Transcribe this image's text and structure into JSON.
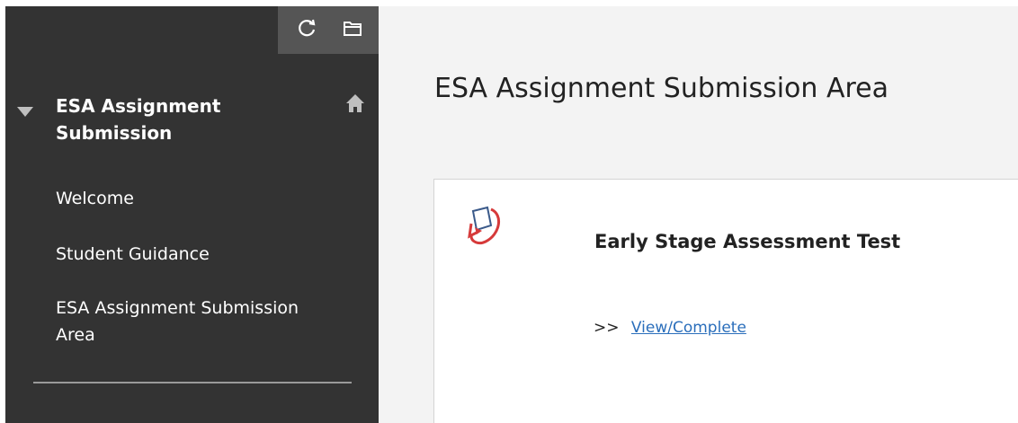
{
  "sidebar": {
    "tools": {
      "refresh_icon": "refresh-icon",
      "folder_icon": "folder-icon"
    },
    "course": {
      "title": "ESA Assignment Submission",
      "caret_icon": "caret-down-icon",
      "home_icon": "home-icon"
    },
    "items": [
      {
        "label": "Welcome"
      },
      {
        "label": "Student Guidance"
      },
      {
        "label": "ESA Assignment Submission Area"
      }
    ]
  },
  "main": {
    "title": "ESA Assignment Submission Area",
    "item": {
      "icon": "assessment-icon",
      "title": "Early Stage Assessment Test",
      "prefix": ">>",
      "link_label": "View/Complete"
    }
  },
  "colors": {
    "sidebar_bg": "#333333",
    "sidebar_tools_bg": "#555555",
    "main_bg": "#f3f3f3",
    "link": "#2a6ebb",
    "icon_red": "#d63a3a"
  }
}
